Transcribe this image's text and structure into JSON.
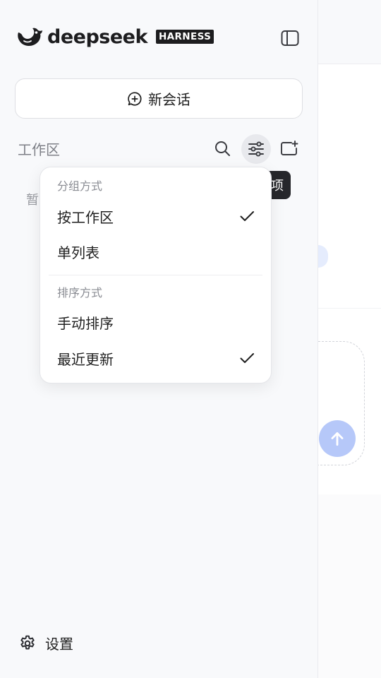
{
  "brand": {
    "wordmark": "deepseek",
    "badge": "HARNESS"
  },
  "sidebar": {
    "new_chat_label": "新会话",
    "workspace_label": "工作区",
    "empty_text": "暂",
    "tooltip_text": "项",
    "settings_label": "设置"
  },
  "dropdown": {
    "group_heading": "分组方式",
    "group_options": [
      {
        "label": "按工作区",
        "checked": true
      },
      {
        "label": "单列表",
        "checked": false
      }
    ],
    "sort_heading": "排序方式",
    "sort_options": [
      {
        "label": "手动排序",
        "checked": false
      },
      {
        "label": "最近更新",
        "checked": true
      }
    ]
  },
  "icons": {
    "logo": "whale-logo-icon",
    "collapse": "sidebar-toggle-icon",
    "new_chat": "plus-chat-icon",
    "search": "search-icon",
    "filter": "sliders-icon",
    "new_folder": "folder-plus-icon",
    "settings": "gear-icon",
    "send": "arrow-up-icon",
    "check": "check-icon"
  },
  "colors": {
    "sidebar_bg": "#f8f9fb",
    "send_button": "#b6c8f9",
    "tooltip_bg": "#26272b",
    "text_primary": "#1f1f1f",
    "text_muted": "#7e8087"
  }
}
